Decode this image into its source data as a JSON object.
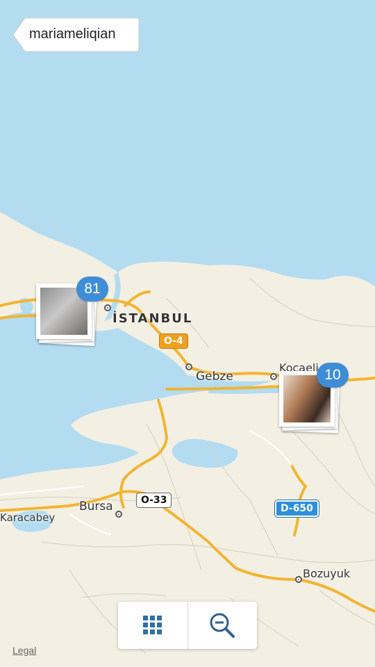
{
  "navigation": {
    "back_label": "mariameliqian"
  },
  "map": {
    "cities": [
      {
        "name": "İSTANBUL"
      },
      {
        "name": "Gebze"
      },
      {
        "name": "Kocaeli"
      },
      {
        "name": "Bursa"
      },
      {
        "name": "Karacabey"
      },
      {
        "name": "Bozuyuk"
      }
    ],
    "road_shields": [
      {
        "label": "O-4",
        "color": "#f0a020"
      },
      {
        "label": "O-33",
        "color": "#ffffff"
      },
      {
        "label": "D-650",
        "color": "#2f8fd8"
      }
    ],
    "colors": {
      "water": "#b3dcf1",
      "land": "#f3efe3",
      "highway": "#f2b431"
    }
  },
  "photo_clusters": [
    {
      "count": "81"
    },
    {
      "count": "10"
    }
  ],
  "toolbar": {
    "grid_icon": "grid-icon",
    "zoom_out_icon": "zoom-out-icon"
  },
  "legal_label": "Legal"
}
